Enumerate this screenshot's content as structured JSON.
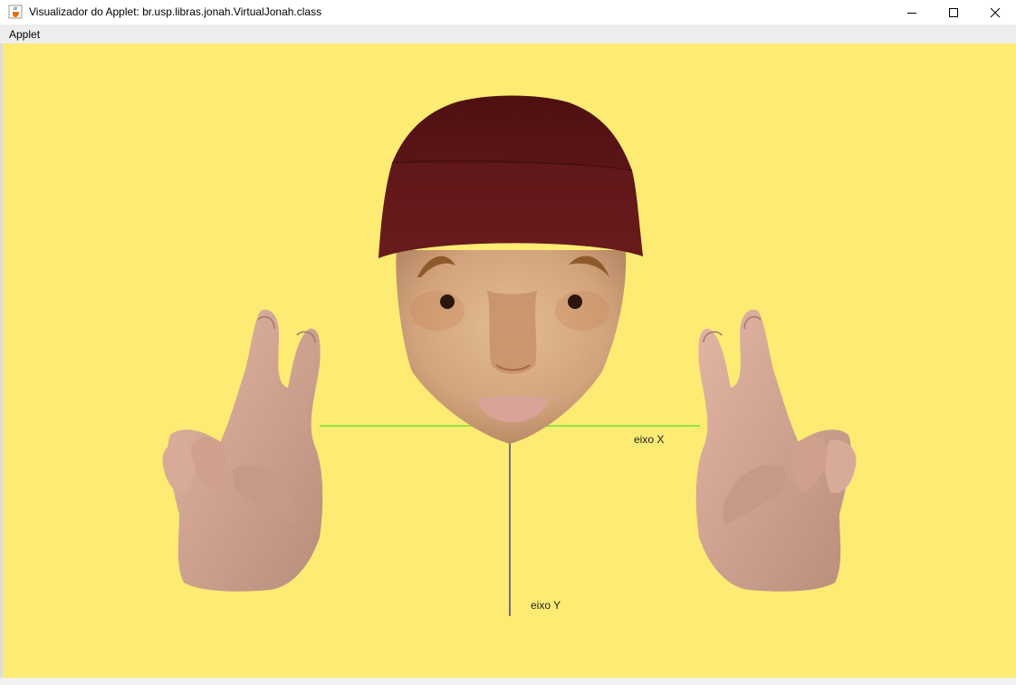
{
  "window": {
    "title": "Visualizador do Applet: br.usp.libras.jonah.VirtualJonah.class",
    "icon": "java-cup-icon",
    "controls": [
      "minimize-icon",
      "maximize-icon",
      "close-icon"
    ]
  },
  "menu": {
    "items": [
      {
        "label": "Applet"
      }
    ]
  },
  "scene": {
    "background_color": "#fdeb74",
    "axis_x_label": "eixo X",
    "axis_y_label": "eixo Y",
    "axis_x_color": "#55dd22",
    "axis_y_color": "#1a1a8a",
    "hat_color": "#661a1c",
    "skin_color": "#d9ae86",
    "hand_color": "#d4a794"
  }
}
